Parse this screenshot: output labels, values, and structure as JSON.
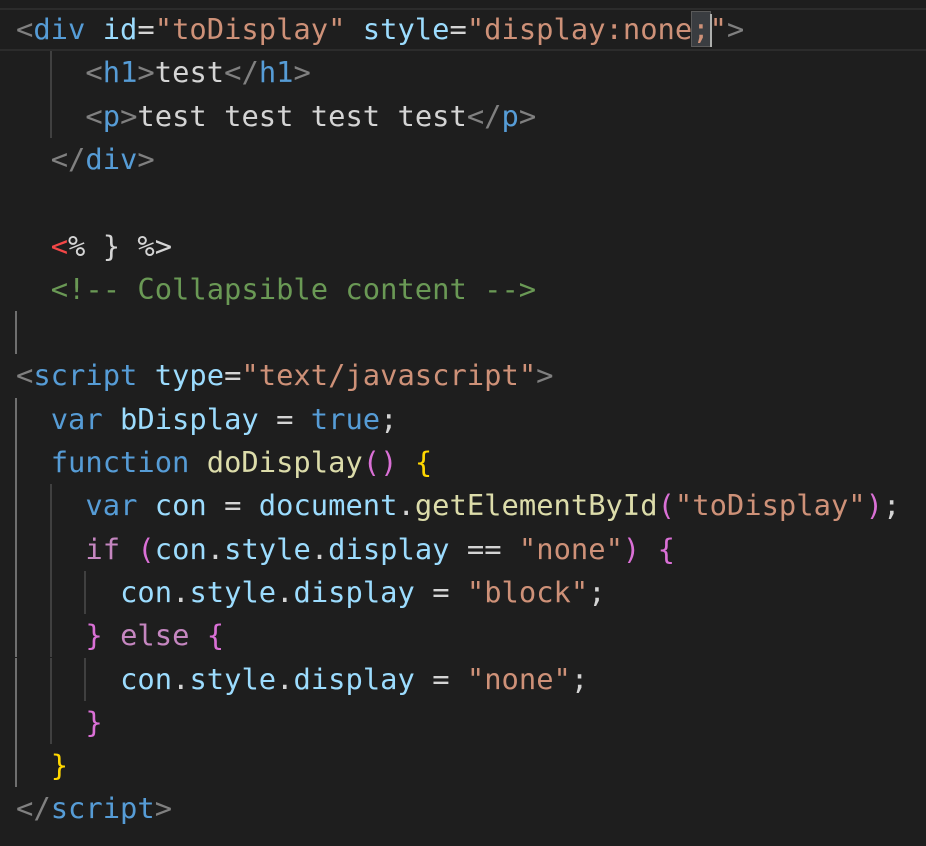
{
  "colors": {
    "background": "#1e1e1e",
    "current_line_border": "#2c2c2c",
    "indent_guide": "#404040",
    "active_indent_guide": "#6f6f6f",
    "cursor": "#aeafad",
    "tag_bracket": "#808080",
    "tag_name": "#569cd6",
    "attribute_name": "#9cdcfe",
    "string": "#ce9178",
    "text": "#d4d4d4",
    "comment": "#6a9955",
    "keyword": "#569cd6",
    "control_keyword": "#c586c0",
    "function_name": "#dcdcaa",
    "variable": "#9cdcfe",
    "bracket_gold": "#ffd700",
    "bracket_purple": "#da70d6",
    "bracket_blue": "#179fff",
    "template_open": "#f44747"
  },
  "lines": [
    {
      "indent": 0,
      "guides": [],
      "current": true,
      "tokens": [
        {
          "t": "<",
          "c": "tag_bracket"
        },
        {
          "t": "div",
          "c": "tag_name"
        },
        {
          "t": " ",
          "c": "text"
        },
        {
          "t": "id",
          "c": "attribute_name"
        },
        {
          "t": "=",
          "c": "text"
        },
        {
          "t": "\"toDisplay\"",
          "c": "string"
        },
        {
          "t": " ",
          "c": "text"
        },
        {
          "t": "style",
          "c": "attribute_name"
        },
        {
          "t": "=",
          "c": "text"
        },
        {
          "t": "\"display:none",
          "c": "string"
        },
        {
          "t": ";",
          "c": "string",
          "hl": true
        },
        {
          "t": "\"",
          "c": "string"
        },
        {
          "t": ">",
          "c": "tag_bracket"
        }
      ]
    },
    {
      "indent": 4,
      "guides": [
        1
      ],
      "tokens": [
        {
          "t": "<",
          "c": "tag_bracket"
        },
        {
          "t": "h1",
          "c": "tag_name"
        },
        {
          "t": ">",
          "c": "tag_bracket"
        },
        {
          "t": "test",
          "c": "text"
        },
        {
          "t": "</",
          "c": "tag_bracket"
        },
        {
          "t": "h1",
          "c": "tag_name"
        },
        {
          "t": ">",
          "c": "tag_bracket"
        }
      ]
    },
    {
      "indent": 4,
      "guides": [
        1
      ],
      "tokens": [
        {
          "t": "<",
          "c": "tag_bracket"
        },
        {
          "t": "p",
          "c": "tag_name"
        },
        {
          "t": ">",
          "c": "tag_bracket"
        },
        {
          "t": "test test test test",
          "c": "text"
        },
        {
          "t": "</",
          "c": "tag_bracket"
        },
        {
          "t": "p",
          "c": "tag_name"
        },
        {
          "t": ">",
          "c": "tag_bracket"
        }
      ]
    },
    {
      "indent": 2,
      "guides": [],
      "tokens": [
        {
          "t": "</",
          "c": "tag_bracket"
        },
        {
          "t": "div",
          "c": "tag_name"
        },
        {
          "t": ">",
          "c": "tag_bracket"
        }
      ]
    },
    {
      "indent": 0,
      "guides": [],
      "tokens": []
    },
    {
      "indent": 2,
      "guides": [],
      "tokens": [
        {
          "t": "<",
          "c": "template_open"
        },
        {
          "t": "% } %>",
          "c": "text"
        }
      ]
    },
    {
      "indent": 2,
      "guides": [],
      "tokens": [
        {
          "t": "<!-- Collapsible content -->",
          "c": "comment"
        }
      ]
    },
    {
      "indent": 0,
      "guides": [
        0
      ],
      "tokens": []
    },
    {
      "indent": 0,
      "guides": [],
      "tokens": [
        {
          "t": "<",
          "c": "tag_bracket"
        },
        {
          "t": "script",
          "c": "tag_name"
        },
        {
          "t": " ",
          "c": "text"
        },
        {
          "t": "type",
          "c": "attribute_name"
        },
        {
          "t": "=",
          "c": "text"
        },
        {
          "t": "\"text/javascript\"",
          "c": "string"
        },
        {
          "t": ">",
          "c": "tag_bracket"
        }
      ]
    },
    {
      "indent": 2,
      "guides": [
        0
      ],
      "tokens": [
        {
          "t": "var",
          "c": "keyword"
        },
        {
          "t": " ",
          "c": "text"
        },
        {
          "t": "bDisplay",
          "c": "variable"
        },
        {
          "t": " = ",
          "c": "text"
        },
        {
          "t": "true",
          "c": "keyword"
        },
        {
          "t": ";",
          "c": "text"
        }
      ]
    },
    {
      "indent": 2,
      "guides": [
        0
      ],
      "tokens": [
        {
          "t": "function",
          "c": "keyword"
        },
        {
          "t": " ",
          "c": "text"
        },
        {
          "t": "doDisplay",
          "c": "function_name"
        },
        {
          "t": "()",
          "c": "bracket_purple"
        },
        {
          "t": " ",
          "c": "text"
        },
        {
          "t": "{",
          "c": "bracket_gold"
        }
      ]
    },
    {
      "indent": 4,
      "guides": [
        0,
        1
      ],
      "tokens": [
        {
          "t": "var",
          "c": "keyword"
        },
        {
          "t": " ",
          "c": "text"
        },
        {
          "t": "con",
          "c": "variable"
        },
        {
          "t": " = ",
          "c": "text"
        },
        {
          "t": "document",
          "c": "variable"
        },
        {
          "t": ".",
          "c": "text"
        },
        {
          "t": "getElementById",
          "c": "function_name"
        },
        {
          "t": "(",
          "c": "bracket_purple"
        },
        {
          "t": "\"toDisplay\"",
          "c": "string"
        },
        {
          "t": ")",
          "c": "bracket_purple"
        },
        {
          "t": ";",
          "c": "text"
        }
      ]
    },
    {
      "indent": 4,
      "guides": [
        0,
        1
      ],
      "tokens": [
        {
          "t": "if",
          "c": "control_keyword"
        },
        {
          "t": " ",
          "c": "text"
        },
        {
          "t": "(",
          "c": "bracket_purple"
        },
        {
          "t": "con",
          "c": "variable"
        },
        {
          "t": ".",
          "c": "text"
        },
        {
          "t": "style",
          "c": "variable"
        },
        {
          "t": ".",
          "c": "text"
        },
        {
          "t": "display",
          "c": "variable"
        },
        {
          "t": " == ",
          "c": "text"
        },
        {
          "t": "\"none\"",
          "c": "string"
        },
        {
          "t": ")",
          "c": "bracket_purple"
        },
        {
          "t": " ",
          "c": "text"
        },
        {
          "t": "{",
          "c": "bracket_purple"
        }
      ]
    },
    {
      "indent": 6,
      "guides": [
        0,
        1,
        2
      ],
      "tokens": [
        {
          "t": "con",
          "c": "variable"
        },
        {
          "t": ".",
          "c": "text"
        },
        {
          "t": "style",
          "c": "variable"
        },
        {
          "t": ".",
          "c": "text"
        },
        {
          "t": "display",
          "c": "variable"
        },
        {
          "t": " = ",
          "c": "text"
        },
        {
          "t": "\"block\"",
          "c": "string"
        },
        {
          "t": ";",
          "c": "text"
        }
      ]
    },
    {
      "indent": 4,
      "guides": [
        0,
        1
      ],
      "tokens": [
        {
          "t": "}",
          "c": "bracket_purple"
        },
        {
          "t": " ",
          "c": "text"
        },
        {
          "t": "else",
          "c": "control_keyword"
        },
        {
          "t": " ",
          "c": "text"
        },
        {
          "t": "{",
          "c": "bracket_purple"
        }
      ]
    },
    {
      "indent": 6,
      "guides": [
        0,
        1,
        2
      ],
      "tokens": [
        {
          "t": "con",
          "c": "variable"
        },
        {
          "t": ".",
          "c": "text"
        },
        {
          "t": "style",
          "c": "variable"
        },
        {
          "t": ".",
          "c": "text"
        },
        {
          "t": "display",
          "c": "variable"
        },
        {
          "t": " = ",
          "c": "text"
        },
        {
          "t": "\"none\"",
          "c": "string"
        },
        {
          "t": ";",
          "c": "text"
        }
      ]
    },
    {
      "indent": 4,
      "guides": [
        0,
        1
      ],
      "tokens": [
        {
          "t": "}",
          "c": "bracket_purple"
        }
      ]
    },
    {
      "indent": 2,
      "guides": [
        0
      ],
      "tokens": [
        {
          "t": "}",
          "c": "bracket_gold"
        }
      ]
    },
    {
      "indent": 0,
      "guides": [],
      "tokens": [
        {
          "t": "</",
          "c": "tag_bracket"
        },
        {
          "t": "script",
          "c": "tag_name"
        },
        {
          "t": ">",
          "c": "tag_bracket"
        }
      ]
    }
  ]
}
